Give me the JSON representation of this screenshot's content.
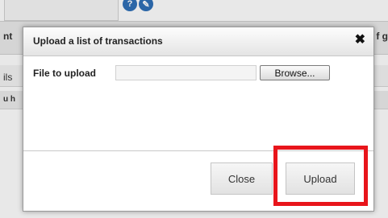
{
  "background": {
    "left_text_1": "nt",
    "left_text_2": "ils",
    "left_text_3": "u h",
    "right_text": "f g",
    "icon_1": "?",
    "icon_2": "✎"
  },
  "modal": {
    "title": "Upload a list of transactions",
    "close_icon": "✖",
    "file_label": "File to upload",
    "file_value": "",
    "browse_label": "Browse...",
    "close_label": "Close",
    "upload_label": "Upload"
  },
  "colors": {
    "highlight": "#e8151b",
    "icon_blue": "#2f6fb6"
  }
}
